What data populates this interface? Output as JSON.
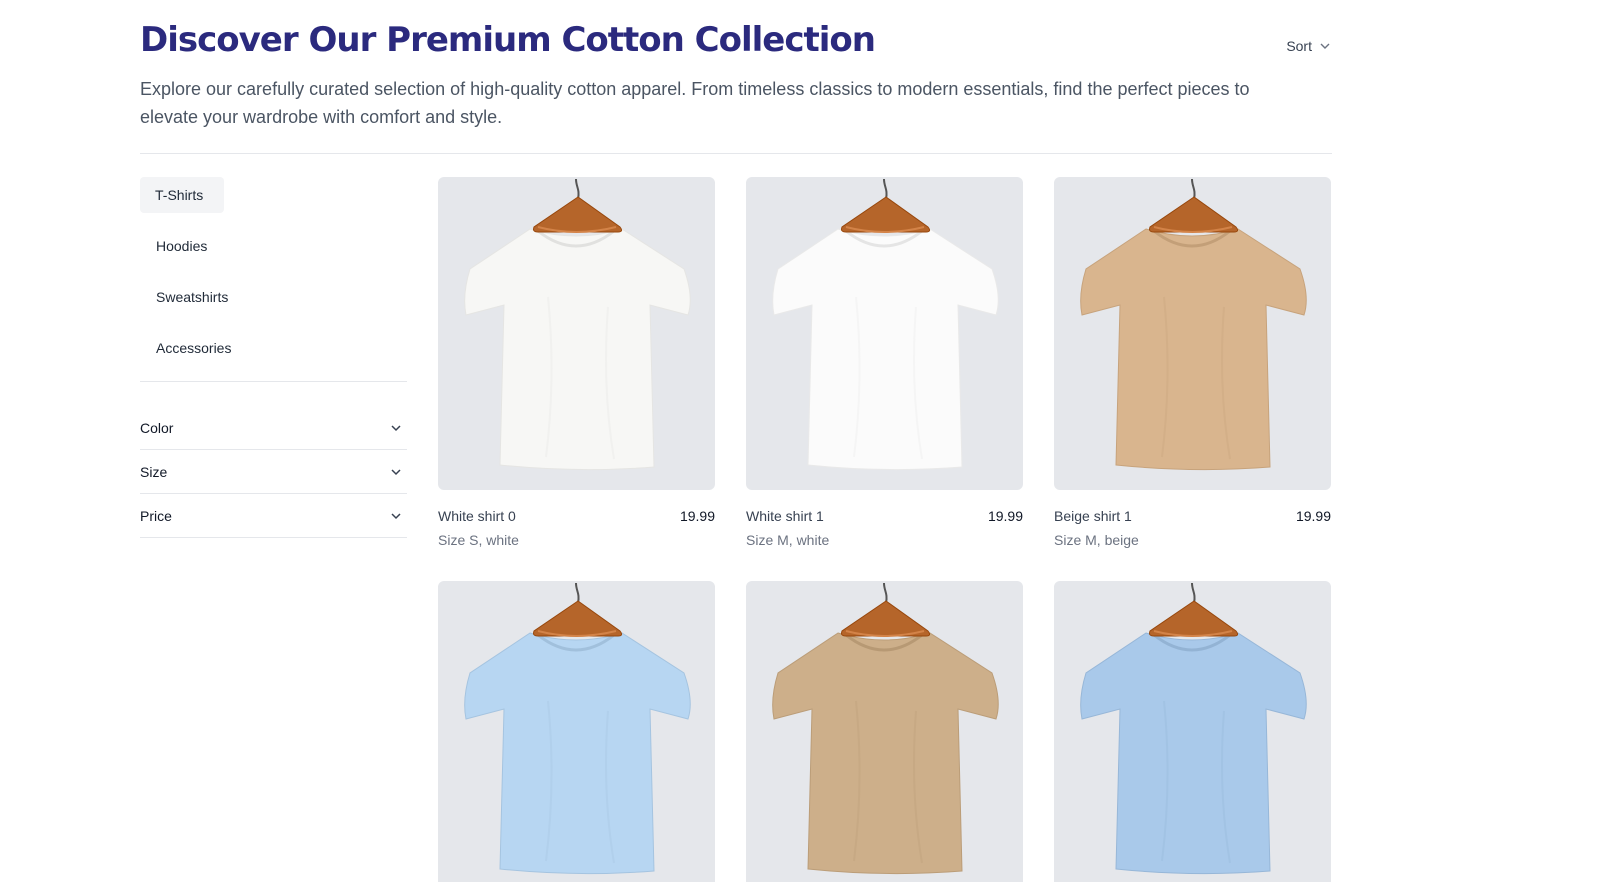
{
  "header": {
    "title": "Discover Our Premium Cotton Collection",
    "subtitle": "Explore our carefully curated selection of high-quality cotton apparel. From timeless classics to modern essentials, find the perfect pieces to elevate your wardrobe with comfort and style.",
    "sort_label": "Sort"
  },
  "sidebar": {
    "categories": [
      {
        "label": "T-Shirts",
        "active": true
      },
      {
        "label": "Hoodies"
      },
      {
        "label": "Sweatshirts"
      },
      {
        "label": "Accessories"
      }
    ],
    "filters": [
      {
        "label": "Color"
      },
      {
        "label": "Size"
      },
      {
        "label": "Price"
      }
    ]
  },
  "products": [
    {
      "name": "White shirt 0",
      "price": "19.99",
      "desc": "Size S, white",
      "color": "#f7f7f5"
    },
    {
      "name": "White shirt 1",
      "price": "19.99",
      "desc": "Size M, white",
      "color": "#fbfbfb"
    },
    {
      "name": "Beige shirt 1",
      "price": "19.99",
      "desc": "Size M, beige",
      "color": "#d9b58e"
    },
    {
      "name": "",
      "price": "",
      "desc": "",
      "color": "#b7d6f2"
    },
    {
      "name": "",
      "price": "",
      "desc": "",
      "color": "#cdaf8a"
    },
    {
      "name": "",
      "price": "",
      "desc": "",
      "color": "#a9c9ea"
    }
  ],
  "colors": {
    "title": "#2b2a7e",
    "thumb_bg": "#e5e7eb",
    "hanger": "#b5652a"
  }
}
